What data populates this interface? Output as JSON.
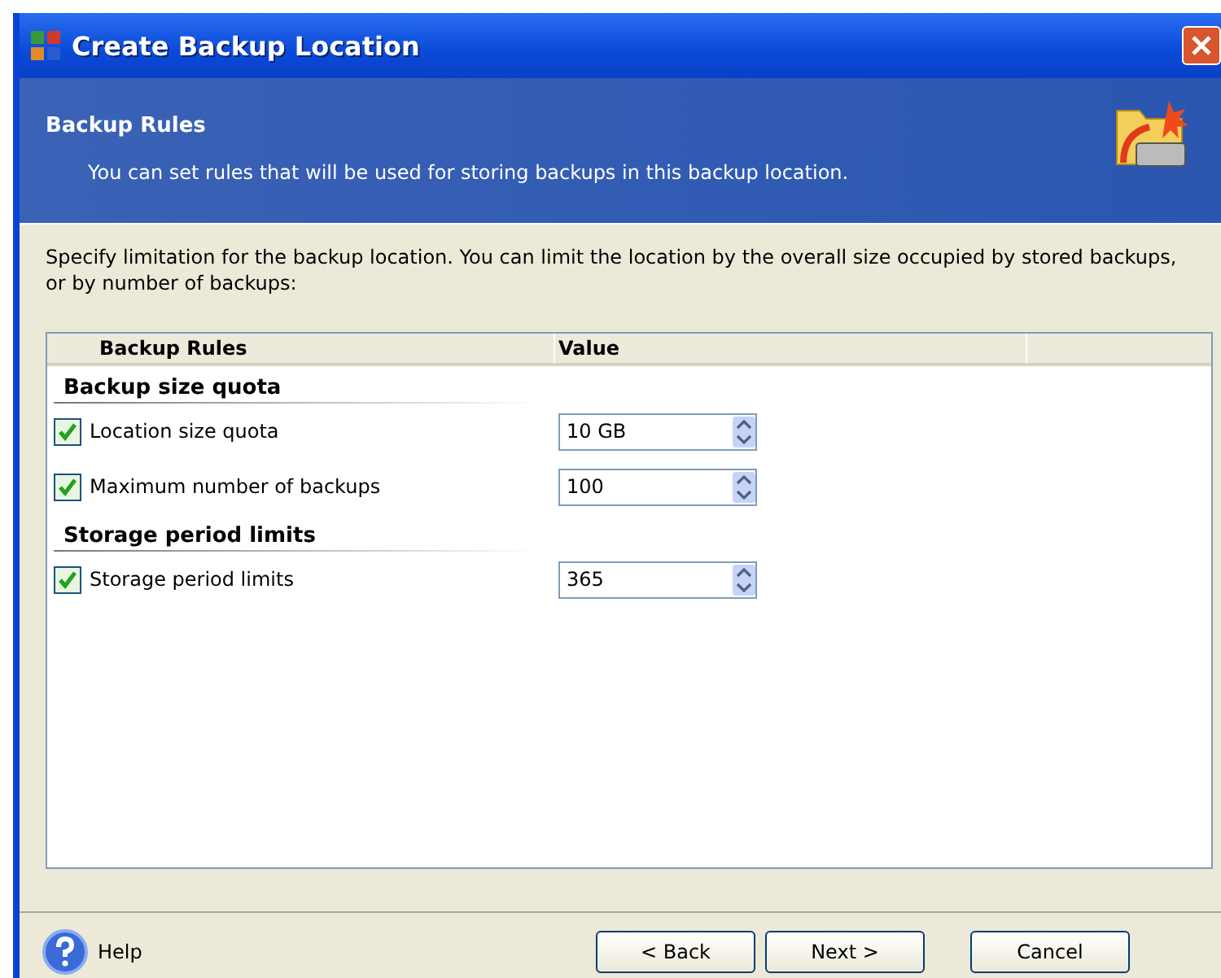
{
  "window": {
    "title": "Create Backup Location"
  },
  "header": {
    "title": "Backup Rules",
    "subtitle": "You can set rules that will be used for storing backups in this backup location."
  },
  "description": "Specify limitation for the backup location. You can limit the location by the overall size occupied by stored backups, or by number of backups:",
  "table": {
    "columns": [
      "Backup Rules",
      "Value"
    ],
    "groups": [
      {
        "title": "Backup size quota",
        "rows": [
          {
            "label": "Location size quota",
            "checked": true,
            "value": "10 GB"
          },
          {
            "label": "Maximum number of backups",
            "checked": true,
            "value": "100"
          }
        ]
      },
      {
        "title": "Storage period limits",
        "rows": [
          {
            "label": "Storage period limits",
            "checked": true,
            "value": "365"
          }
        ]
      }
    ]
  },
  "footer": {
    "help": "Help",
    "buttons": [
      "< Back",
      "Next >",
      "Cancel"
    ]
  }
}
